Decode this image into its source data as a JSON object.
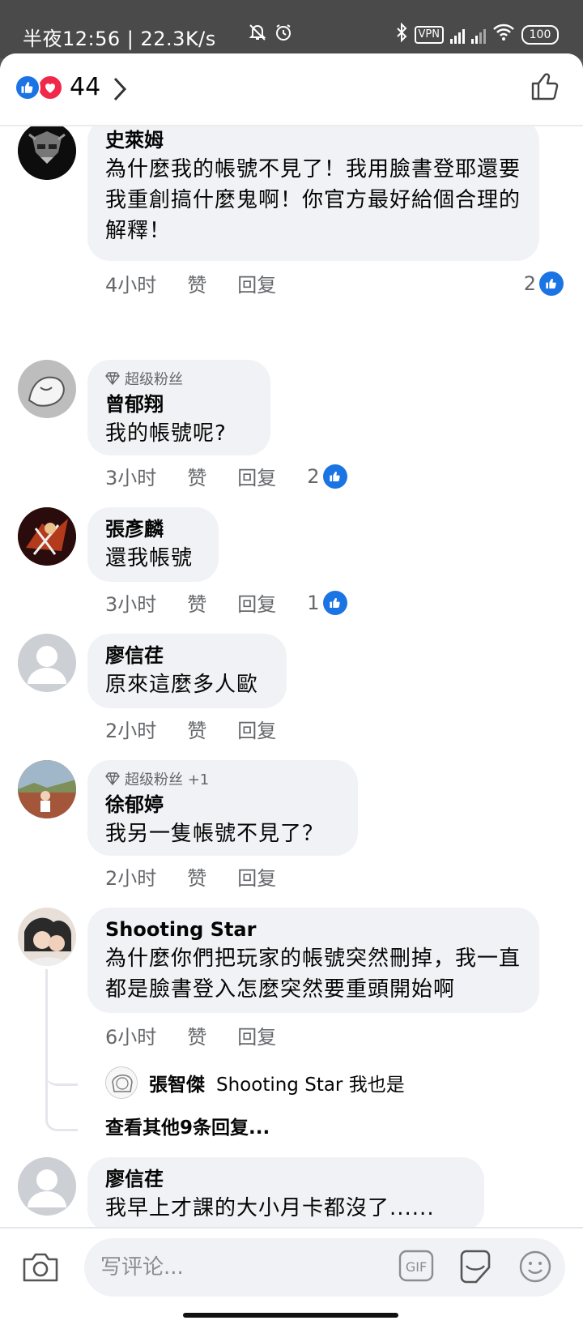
{
  "status_bar": {
    "time": "半夜12:56 | 22.3K/s",
    "vpn": "VPN",
    "battery": "100"
  },
  "header": {
    "reaction_count": "44",
    "reaction_icons": [
      "like-icon",
      "love-icon"
    ]
  },
  "comments": [
    {
      "author": "史萊姆",
      "text": "為什麼我的帳號不見了！我用臉書登耶還要我重創搞什麼鬼啊！你官方最好給個合理的解釋！",
      "time": "4小时",
      "like_label": "赞",
      "reply_label": "回复",
      "likes": "2"
    },
    {
      "badge": "超级粉丝",
      "author": "曾郁翔",
      "text": "我的帳號呢?",
      "time": "3小时",
      "like_label": "赞",
      "reply_label": "回复",
      "likes": "2"
    },
    {
      "author": "張彥麟",
      "text": "還我帳號",
      "time": "3小时",
      "like_label": "赞",
      "reply_label": "回复",
      "likes": "1"
    },
    {
      "author": "廖信荏",
      "text": "原來這麼多人歐",
      "time": "2小时",
      "like_label": "赞",
      "reply_label": "回复"
    },
    {
      "badge": "超级粉丝 +1",
      "author": "徐郁婷",
      "text": "我另一隻帳號不見了？",
      "time": "2小时",
      "like_label": "赞",
      "reply_label": "回复"
    },
    {
      "author": "Shooting Star",
      "text": "為什麼你們把玩家的帳號突然刪掉，我一直都是臉書登入怎麼突然要重頭開始啊",
      "time": "6小时",
      "like_label": "赞",
      "reply_label": "回复",
      "reply_preview": {
        "author": "張智傑",
        "text": "Shooting Star 我也是"
      },
      "more_replies": "查看其他9条回复..."
    },
    {
      "author": "廖信荏",
      "text": "我早上才課的大小月卡都沒了......"
    }
  ],
  "composer": {
    "placeholder": "写评论...",
    "gif_label": "GIF"
  },
  "colors": {
    "facebook_blue": "#1b74e4",
    "love_red": "#f02849",
    "bubble_gray": "#f0f2f5",
    "meta_gray": "#65676b"
  }
}
